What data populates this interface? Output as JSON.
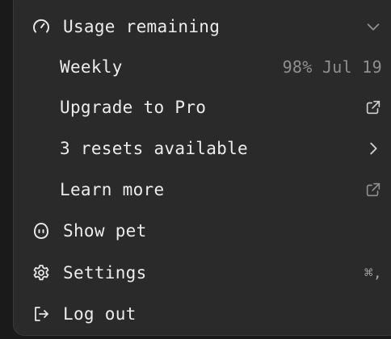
{
  "menu": {
    "usage": {
      "label": "Usage remaining",
      "icon": "gauge-icon",
      "trailing_icon": "chevron-down-icon"
    },
    "weekly": {
      "label": "Weekly",
      "value": "98% Jul 19"
    },
    "upgrade": {
      "label": "Upgrade to Pro",
      "trailing_icon": "external-link-icon"
    },
    "resets": {
      "label": "3 resets available",
      "trailing_icon": "chevron-right-icon"
    },
    "learn_more": {
      "label": "Learn more",
      "trailing_icon": "external-link-icon"
    },
    "pet": {
      "label": "Show pet",
      "icon": "pet-icon"
    },
    "settings": {
      "label": "Settings",
      "icon": "gear-icon",
      "shortcut": "⌘,"
    },
    "logout": {
      "label": "Log out",
      "icon": "logout-icon"
    }
  }
}
